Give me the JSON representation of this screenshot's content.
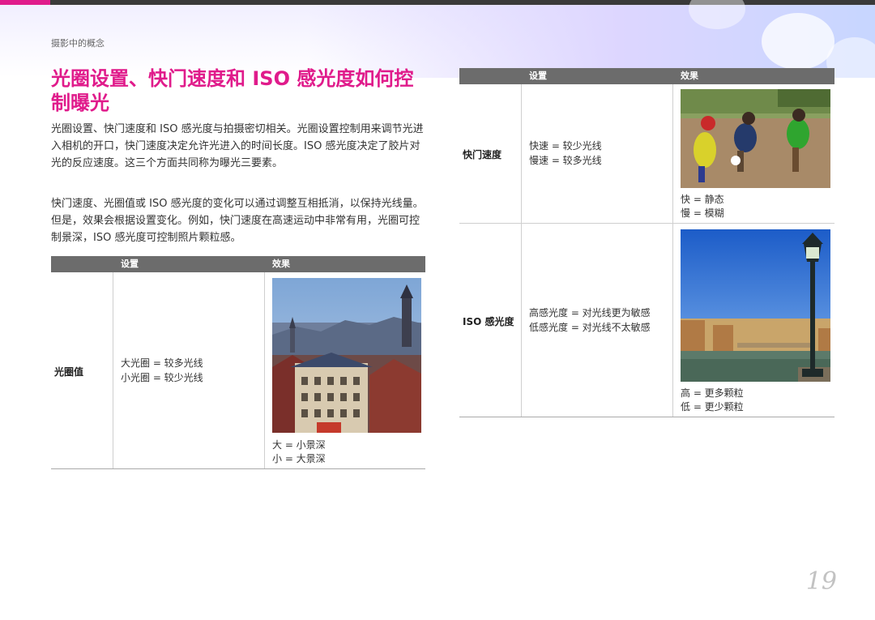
{
  "page": {
    "breadcrumb": "摄影中的概念",
    "title": "光圈设置、快门速度和 ISO 感光度如何控制曝光",
    "paragraphs": [
      "光圈设置、快门速度和 ISO 感光度与拍摄密切相关。光圈设置控制用来调节光进入相机的开口，快门速度决定允许光进入的时间长度。ISO 感光度决定了胶片对光的反应速度。这三个方面共同称为曝光三要素。",
      "快门速度、光圈值或 ISO 感光度的变化可以通过调整互相抵消，以保持光线量。但是，效果会根据设置变化。例如，快门速度在高速运动中非常有用，光圈可控制景深，ISO 感光度可控制照片颗粒感。"
    ],
    "page_number": "19",
    "accent_color": "#e01b8b"
  },
  "table_left": {
    "header_setting": "设置",
    "header_effect": "效果",
    "rows": [
      {
        "label": "光圈值",
        "setting_lines": [
          "大光圈 = 较多光线",
          "小光圈 = 较少光线"
        ],
        "effect_lines": [
          "大 = 小景深",
          "小 = 大景深"
        ],
        "image": "city-rooftops-photo"
      }
    ]
  },
  "table_right": {
    "header_setting": "设置",
    "header_effect": "效果",
    "rows": [
      {
        "label": "快门速度",
        "setting_lines": [
          "快速 = 较少光线",
          "慢速 = 较多光线"
        ],
        "effect_lines": [
          "快 = 静态",
          "慢 = 模糊"
        ],
        "image": "kids-soccer-photo"
      },
      {
        "label": "ISO 感光度",
        "setting_lines": [
          "高感光度 = 对光线更为敏感",
          "低感光度 = 对光线不太敏感"
        ],
        "effect_lines": [
          "高 = 更多颗粒",
          "低 = 更少颗粒"
        ],
        "image": "river-lamppost-photo"
      }
    ]
  }
}
